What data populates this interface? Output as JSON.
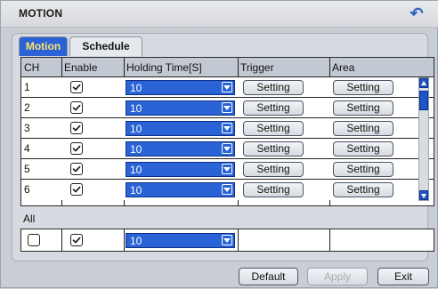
{
  "title": "MOTION",
  "icons": {
    "back": "back-arrow-icon"
  },
  "tabs": [
    {
      "label": "Motion"
    },
    {
      "label": "Schedule"
    }
  ],
  "table": {
    "headers": [
      "CH",
      "Enable",
      "Holding Time[S]",
      "Trigger",
      "Area"
    ],
    "rows": [
      {
        "ch": "1",
        "holding": "10",
        "trigger": "Setting",
        "area": "Setting"
      },
      {
        "ch": "2",
        "holding": "10",
        "trigger": "Setting",
        "area": "Setting"
      },
      {
        "ch": "3",
        "holding": "10",
        "trigger": "Setting",
        "area": "Setting"
      },
      {
        "ch": "4",
        "holding": "10",
        "trigger": "Setting",
        "area": "Setting"
      },
      {
        "ch": "5",
        "holding": "10",
        "trigger": "Setting",
        "area": "Setting"
      },
      {
        "ch": "6",
        "holding": "10",
        "trigger": "Setting",
        "area": "Setting"
      }
    ]
  },
  "all": {
    "label": "All",
    "holding": "10"
  },
  "buttons": {
    "default": "Default",
    "apply": "Apply",
    "exit": "Exit"
  },
  "colors": {
    "accent": "#2b63d6",
    "tab_active_text": "#ffe56a"
  }
}
